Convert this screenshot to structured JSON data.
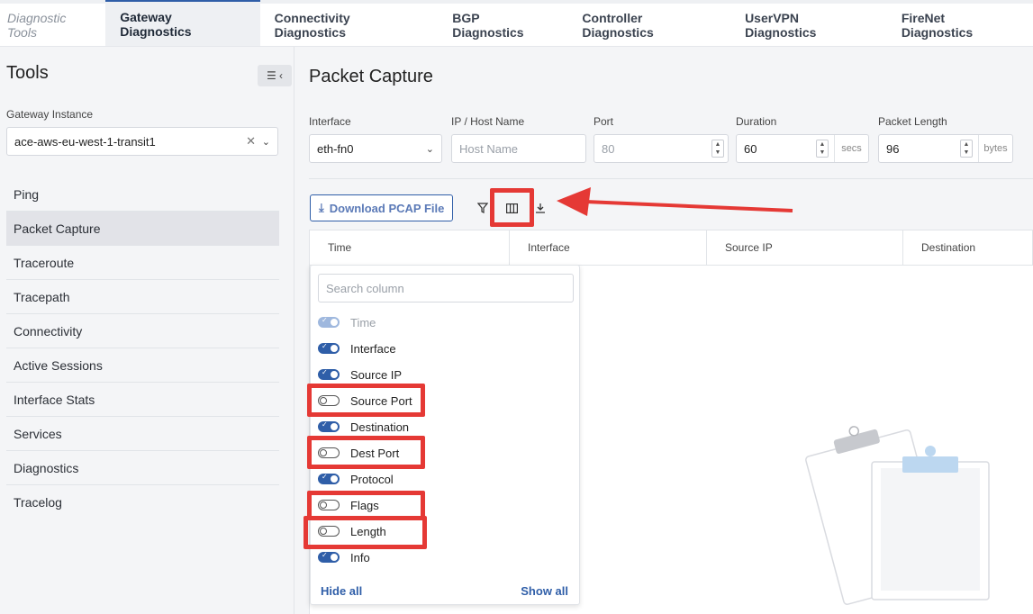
{
  "topbar": {
    "brand": "Diagnostic Tools",
    "tabs": [
      "Gateway Diagnostics",
      "Connectivity Diagnostics",
      "BGP Diagnostics",
      "Controller Diagnostics",
      "UserVPN Diagnostics",
      "FireNet Diagnostics"
    ]
  },
  "sidebar": {
    "title": "Tools",
    "gateway_label": "Gateway Instance",
    "gateway_value": "ace-aws-eu-west-1-transit1",
    "items": [
      "Ping",
      "Packet Capture",
      "Traceroute",
      "Tracepath",
      "Connectivity",
      "Active Sessions",
      "Interface Stats",
      "Services",
      "Diagnostics",
      "Tracelog"
    ],
    "active_index": 1
  },
  "main": {
    "title": "Packet Capture",
    "fields": {
      "interface_label": "Interface",
      "interface_value": "eth-fn0",
      "host_label": "IP / Host Name",
      "host_placeholder": "Host Name",
      "port_label": "Port",
      "port_placeholder": "80",
      "duration_label": "Duration",
      "duration_value": "60",
      "duration_unit": "secs",
      "length_label": "Packet Length",
      "length_value": "96",
      "length_unit": "bytes"
    },
    "download_label": "Download PCAP File",
    "columns": [
      "Time",
      "Interface",
      "Source IP",
      "Destination"
    ]
  },
  "column_menu": {
    "search_placeholder": "Search column",
    "items": [
      {
        "label": "Time",
        "state": "disabled"
      },
      {
        "label": "Interface",
        "state": "on"
      },
      {
        "label": "Source IP",
        "state": "on"
      },
      {
        "label": "Source Port",
        "state": "off"
      },
      {
        "label": "Destination",
        "state": "on"
      },
      {
        "label": "Dest Port",
        "state": "off"
      },
      {
        "label": "Protocol",
        "state": "on"
      },
      {
        "label": "Flags",
        "state": "off"
      },
      {
        "label": "Length",
        "state": "off"
      },
      {
        "label": "Info",
        "state": "on"
      }
    ],
    "hide_all": "Hide all",
    "show_all": "Show all"
  },
  "colors": {
    "accent": "#2f5ea8",
    "annotation": "#e53935"
  }
}
